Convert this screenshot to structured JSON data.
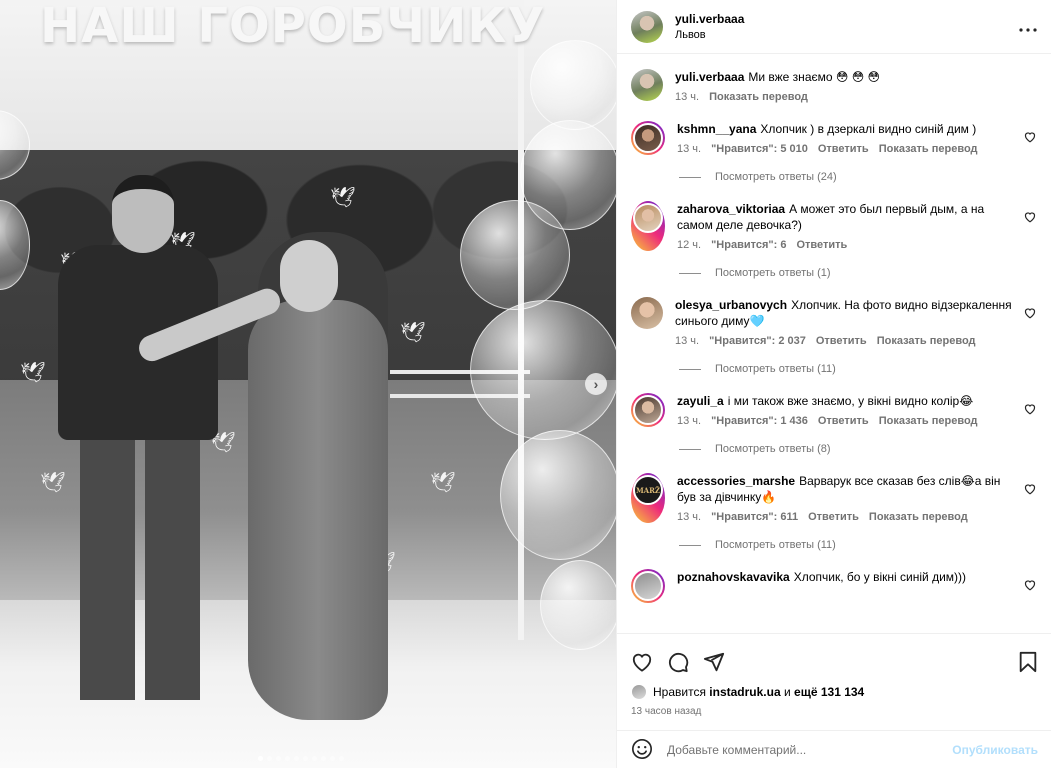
{
  "post": {
    "author": "yuli.verbaaa",
    "location": "Львов",
    "sign_text": "НАШ ГОРОБЧИКУ"
  },
  "media": {
    "image_count": 10,
    "active_index": 0,
    "next_icon": "chevron-right-icon"
  },
  "comments": [
    {
      "user": "yuli.verbaaa",
      "text": "Ми вже знаємо 😳 😳 😳",
      "time": "13 ч.",
      "likes": "",
      "reply_label": "",
      "translate_label": "Показать перевод",
      "replies_label": "",
      "avatar": "av-a",
      "story_ring": false,
      "caption": true
    },
    {
      "user": "kshmn__yana",
      "text": "Хлопчик ) в дзеркалі видно синій дим )",
      "time": "13 ч.",
      "likes": "\"Нравится\": 5 010",
      "reply_label": "Ответить",
      "translate_label": "Показать перевод",
      "replies_label": "Посмотреть ответы (24)",
      "avatar": "av-b",
      "story_ring": true
    },
    {
      "user": "zaharova_viktoriaa",
      "text": "А может это был первый дым, а на самом деле девочка?)",
      "time": "12 ч.",
      "likes": "\"Нравится\": 6",
      "reply_label": "Ответить",
      "translate_label": "",
      "replies_label": "Посмотреть ответы (1)",
      "avatar": "av-c",
      "story_ring": true
    },
    {
      "user": "olesya_urbanovych",
      "text": "Хлопчик. На фото видно відзеркалення синього диму🩵",
      "time": "13 ч.",
      "likes": "\"Нравится\": 2 037",
      "reply_label": "Ответить",
      "translate_label": "Показать перевод",
      "replies_label": "Посмотреть ответы (11)",
      "avatar": "av-d",
      "story_ring": false
    },
    {
      "user": "zayuli_a",
      "text": "і ми також вже знаємо, у вікні видно колір😂",
      "time": "13 ч.",
      "likes": "\"Нравится\": 1 436",
      "reply_label": "Ответить",
      "translate_label": "Показать перевод",
      "replies_label": "Посмотреть ответы (8)",
      "avatar": "av-e",
      "story_ring": true
    },
    {
      "user": "accessories_marshe",
      "text": "Варварук все сказав без слів😂а він був за дівчинку🔥",
      "time": "13 ч.",
      "likes": "\"Нравится\": 611",
      "reply_label": "Ответить",
      "translate_label": "Показать перевод",
      "replies_label": "Посмотреть ответы (11)",
      "avatar": "av-f",
      "avatar_text": "MARŽ",
      "story_ring": true
    },
    {
      "user": "poznahovskavavika",
      "text": "Хлопчик, бо у вікні синій дим)))",
      "time": "",
      "likes": "",
      "reply_label": "",
      "translate_label": "",
      "replies_label": "",
      "avatar": "av-g",
      "story_ring": true
    }
  ],
  "actions": {
    "like_icon": "heart-icon",
    "comment_icon": "comment-bubble-icon",
    "share_icon": "paper-plane-icon",
    "save_icon": "bookmark-icon"
  },
  "likes_summary": {
    "prefix": "Нравится",
    "first_user": "instadruk.ua",
    "connector": "и",
    "others": "ещё 131 134"
  },
  "posted_ago": "13 часов назад",
  "add_comment": {
    "emoji_icon": "emoji-smiley-icon",
    "placeholder": "Добавьте комментарий...",
    "publish_label": "Опубликовать"
  },
  "colors": {
    "link_blue_disabled": "#b2dffc",
    "secondary_text": "#737373",
    "divider": "#efefef"
  }
}
